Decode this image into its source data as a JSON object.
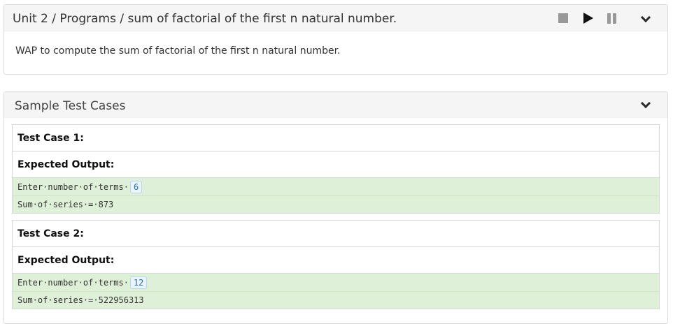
{
  "problem": {
    "breadcrumb": "Unit 2 / Programs / sum of factorial of the first n natural number.",
    "description": "WAP to compute the sum of factorial of the first n natural number.",
    "controls": [
      "stop-icon",
      "play-icon",
      "pause-icon",
      "chevron-down-icon"
    ]
  },
  "samples": {
    "title": "Sample Test Cases",
    "cases": [
      {
        "label": "Test Case 1:",
        "expected_label": "Expected Output:",
        "prompt": "Enter·number·of·terms·",
        "input": "6",
        "result": "Sum·of·series·=·873"
      },
      {
        "label": "Test Case 2:",
        "expected_label": "Expected Output:",
        "prompt": "Enter·number·of·terms·",
        "input": "12",
        "result": "Sum·of·series·=·522956313"
      }
    ]
  },
  "colors": {
    "output_bg": "#dff0d8",
    "header_bg": "#f5f5f5",
    "input_badge": "#2a6fa8"
  }
}
